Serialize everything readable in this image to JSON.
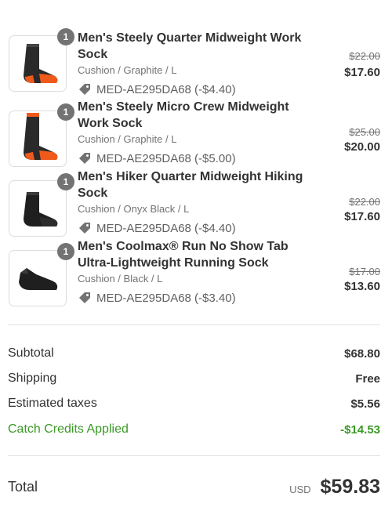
{
  "items": [
    {
      "qty": "1",
      "name": "Men's Steely Quarter Midweight Work Sock",
      "variant": "Cushion / Graphite / L",
      "discount": "MED-AE295DA68 (-$4.40)",
      "original_price": "$22.00",
      "price": "$17.60",
      "icon": "quarter-sock-orange-toe"
    },
    {
      "qty": "1",
      "name": "Men's Steely Micro Crew Midweight Work Sock",
      "variant": "Cushion / Graphite / L",
      "discount": "MED-AE295DA68 (-$5.00)",
      "original_price": "$25.00",
      "price": "$20.00",
      "icon": "crew-sock-orange-toe"
    },
    {
      "qty": "1",
      "name": "Men's Hiker Quarter Midweight Hiking Sock",
      "variant": "Cushion / Onyx Black / L",
      "discount": "MED-AE295DA68 (-$4.40)",
      "original_price": "$22.00",
      "price": "$17.60",
      "icon": "quarter-sock-black"
    },
    {
      "qty": "1",
      "name": "Men's Coolmax® Run No Show Tab Ultra-Lightweight Running Sock",
      "variant": "Cushion / Black / L",
      "discount": "MED-AE295DA68 (-$3.40)",
      "original_price": "$17.00",
      "price": "$13.60",
      "icon": "no-show-sock-black"
    }
  ],
  "summary": {
    "subtotal_label": "Subtotal",
    "subtotal_value": "$68.80",
    "shipping_label": "Shipping",
    "shipping_value": "Free",
    "taxes_label": "Estimated taxes",
    "taxes_value": "$5.56",
    "credits_label": "Catch Credits Applied",
    "credits_value": "-$14.53",
    "total_label": "Total",
    "currency": "USD",
    "total_value": "$59.83"
  },
  "colors": {
    "credits_green": "#3a9a25",
    "badge_gray": "#737373",
    "sock_orange": "#ef5a1c"
  }
}
